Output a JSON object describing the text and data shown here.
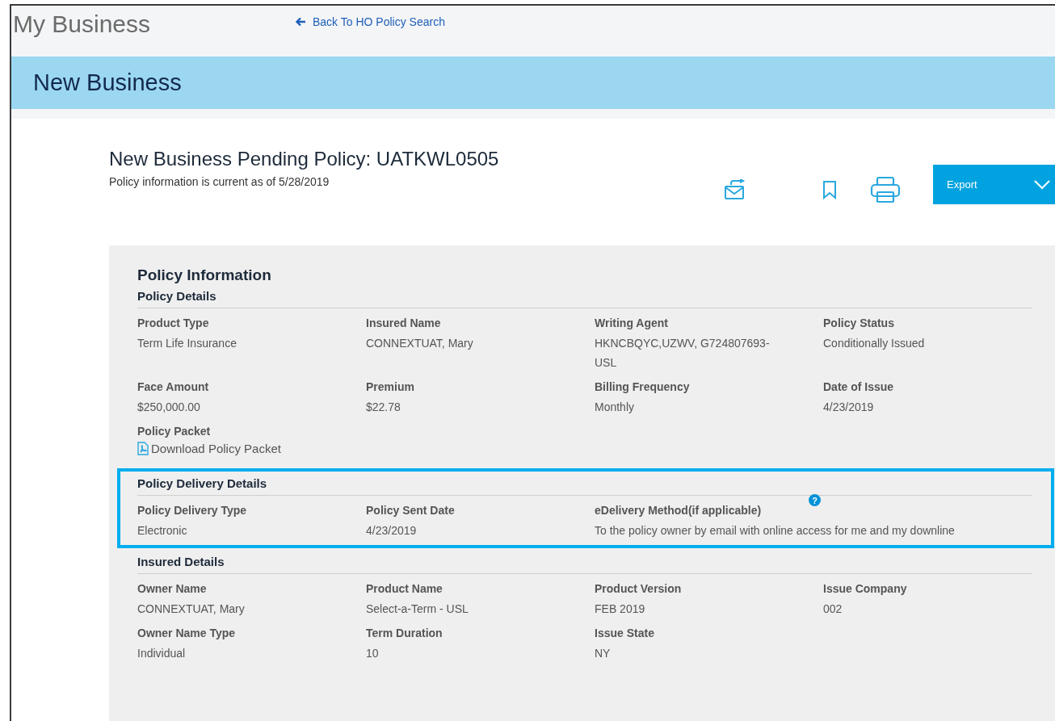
{
  "header": {
    "title": "My Business",
    "back_link": "Back To HO Policy Search"
  },
  "banner": {
    "title": "New Business"
  },
  "policy": {
    "title": "New Business Pending Policy: UATKWL0505",
    "subtitle": "Policy information is current as of 5/28/2019"
  },
  "toolbar": {
    "export_button": "Export"
  },
  "panel": {
    "title": "Policy Information",
    "sections": [
      {
        "title": "Policy Details",
        "highlighted": false,
        "fields": [
          {
            "kind": "text",
            "label": "Product Type",
            "value": "Term Life Insurance"
          },
          {
            "kind": "text",
            "label": "Insured Name",
            "value": "CONNEXTUAT, Mary"
          },
          {
            "kind": "text",
            "label": "Writing Agent",
            "value": "HKNCBQYC,UZWV, G724807693-USL"
          },
          {
            "kind": "text",
            "label": "Policy Status",
            "value": "Conditionally Issued"
          },
          {
            "kind": "text",
            "label": "Face Amount",
            "value": "$250,000.00"
          },
          {
            "kind": "text",
            "label": "Premium",
            "value": "$22.78"
          },
          {
            "kind": "text",
            "label": "Billing Frequency",
            "value": "Monthly"
          },
          {
            "kind": "text",
            "label": "Date of Issue",
            "value": "4/23/2019"
          },
          {
            "kind": "download",
            "label": "Policy Packet",
            "value": "Download Policy Packet"
          }
        ]
      },
      {
        "title": "Policy Delivery Details",
        "highlighted": true,
        "fields": [
          {
            "kind": "text",
            "label": "Policy Delivery Type",
            "value": "Electronic"
          },
          {
            "kind": "text",
            "label": "Policy Sent Date",
            "value": "4/23/2019"
          },
          {
            "kind": "help",
            "label": "eDelivery Method(if applicable)",
            "value": "To the policy owner by email with online access for me and my downline",
            "help": "?"
          }
        ]
      },
      {
        "title": "Insured Details",
        "highlighted": false,
        "fields": [
          {
            "kind": "text",
            "label": "Owner Name",
            "value": "CONNEXTUAT, Mary"
          },
          {
            "kind": "text",
            "label": "Product Name",
            "value": "Select-a-Term - USL"
          },
          {
            "kind": "text",
            "label": "Product Version",
            "value": "FEB 2019"
          },
          {
            "kind": "text",
            "label": "Issue Company",
            "value": "002"
          },
          {
            "kind": "text",
            "label": "Owner Name Type",
            "value": "Individual"
          },
          {
            "kind": "text",
            "label": "Term Duration",
            "value": "10"
          },
          {
            "kind": "text",
            "label": "Issue State",
            "value": "NY"
          }
        ]
      }
    ]
  }
}
